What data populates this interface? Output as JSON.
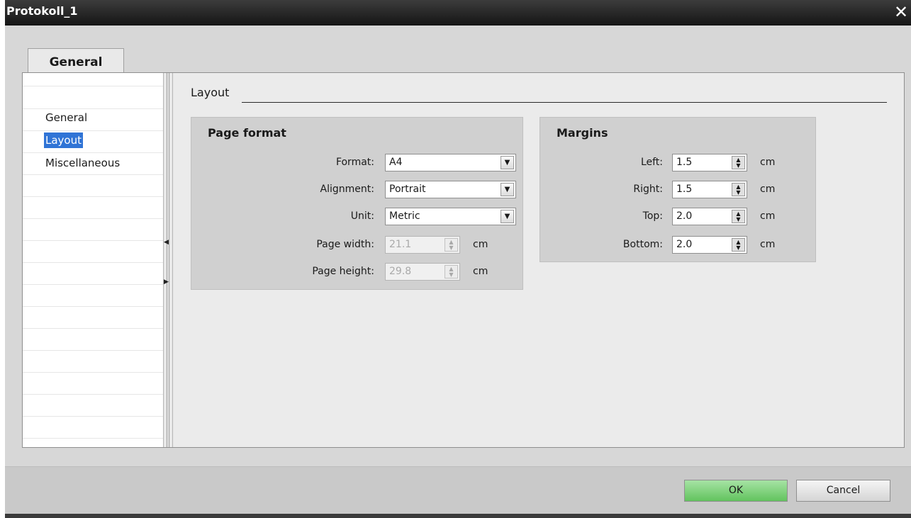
{
  "window": {
    "title": "Protokoll_1",
    "close_glyph": "✕"
  },
  "tabs": [
    {
      "label": "General"
    }
  ],
  "nav": {
    "items": [
      {
        "label": "General"
      },
      {
        "label": "Layout"
      },
      {
        "label": "Miscellaneous"
      }
    ],
    "selected": "Layout"
  },
  "section": {
    "title": "Layout"
  },
  "page_format": {
    "title": "Page format",
    "format": {
      "label": "Format:",
      "value": "A4"
    },
    "alignment": {
      "label": "Alignment:",
      "value": "Portrait"
    },
    "unit": {
      "label": "Unit:",
      "value": "Metric"
    },
    "page_width": {
      "label": "Page width:",
      "value": "21.1",
      "unit": "cm",
      "disabled": true
    },
    "page_height": {
      "label": "Page height:",
      "value": "29.8",
      "unit": "cm",
      "disabled": true
    }
  },
  "margins": {
    "title": "Margins",
    "left": {
      "label": "Left:",
      "value": "1.5",
      "unit": "cm"
    },
    "right": {
      "label": "Right:",
      "value": "1.5",
      "unit": "cm"
    },
    "top": {
      "label": "Top:",
      "value": "2.0",
      "unit": "cm"
    },
    "bottom": {
      "label": "Bottom:",
      "value": "2.0",
      "unit": "cm"
    }
  },
  "footer": {
    "ok_label": "OK",
    "cancel_label": "Cancel"
  },
  "colors": {
    "accent": "#3074d6",
    "ok_button": "#7fd27c",
    "title_bar": "#1e1e1e",
    "panel": "#d7d7d7"
  },
  "icons": {
    "close": "close-icon",
    "dropdown": "chevron-down-icon",
    "spinner": "spinner-icon"
  }
}
